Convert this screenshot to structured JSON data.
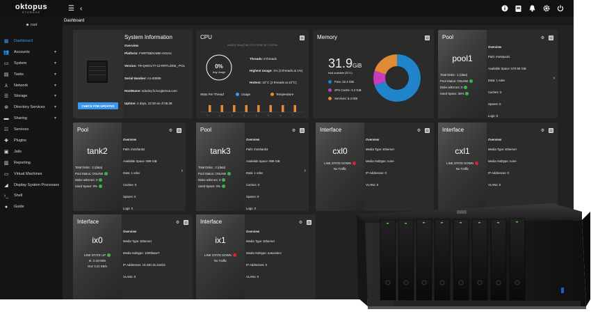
{
  "topbar": {
    "logo": "oktopus",
    "logo_sub": "STORAGE"
  },
  "breadcrumb": "Dashboard",
  "user": "root",
  "sidebar": {
    "items": [
      {
        "label": "Dashboard",
        "icon": "dashboard-icon",
        "active": true
      },
      {
        "label": "Accounts",
        "icon": "accounts-icon",
        "caret": true
      },
      {
        "label": "System",
        "icon": "system-icon",
        "caret": true
      },
      {
        "label": "Tasks",
        "icon": "tasks-icon",
        "caret": true
      },
      {
        "label": "Network",
        "icon": "network-icon",
        "caret": true
      },
      {
        "label": "Storage",
        "icon": "storage-icon",
        "caret": true
      },
      {
        "label": "Directory Services",
        "icon": "directory-icon",
        "caret": true
      },
      {
        "label": "Sharing",
        "icon": "sharing-icon",
        "caret": true
      },
      {
        "label": "Services",
        "icon": "services-icon"
      },
      {
        "label": "Plugins",
        "icon": "plugins-icon"
      },
      {
        "label": "Jails",
        "icon": "jails-icon"
      },
      {
        "label": "Reporting",
        "icon": "reporting-icon"
      },
      {
        "label": "Virtual Machines",
        "icon": "vm-icon"
      },
      {
        "label": "Display System Processes",
        "icon": "processes-icon"
      },
      {
        "label": "Shell",
        "icon": "shell-icon"
      },
      {
        "label": "Guide",
        "icon": "guide-icon"
      }
    ]
  },
  "sysinfo": {
    "title": "System Information",
    "overview": "Overview",
    "platform_label": "Platform:",
    "platform": "FWRTBBXABB AXGAx",
    "version_label": "Version:",
    "version": "TR-QWOLTT-12-RRTLZEM_-POL",
    "serial_label": "Serial Number:",
    "serial": "A1-83888",
    "hostname_label": "HostName:",
    "hostname": "sdudny.fx.bcrglemxa.com",
    "uptime_label": "Uptime:",
    "uptime": "4 days, 22:30 as of 05:38",
    "button": "CHECK FOR UPDATES"
  },
  "cpu": {
    "title": "CPU",
    "model": "Intel(R) Xeon(TM) CPU E3786 @ 2.20GHz",
    "avg_value": "0%",
    "avg_label": "Avg Usage",
    "threads_label": "Threads:",
    "threads": "8 threads",
    "highest_usage_label": "Highest Usage:",
    "highest_usage": "1% (3 threads at 1%)",
    "hottest_label": "Hottest:",
    "hottest": "42°C (2 threads at 42°C)",
    "stats_label": "Stats Per Thread",
    "legend_usage": "Usage",
    "legend_temp": "Temperature",
    "usage_color": "#3a98f0",
    "temp_color": "#e88a35",
    "thread_ticks": [
      "0",
      "1",
      "2",
      "3",
      "4",
      "5",
      "6",
      "7"
    ],
    "thread_temps": [
      0.42,
      0.42,
      0.42,
      0.42,
      0.42,
      0.42,
      0.42,
      0.42
    ]
  },
  "memory": {
    "title": "Memory",
    "total": "31.9",
    "unit": "GiB",
    "total_label": "total available (ECC)",
    "legend": [
      {
        "label": "Free: 22.4 GiB",
        "color": "#1f84c9"
      },
      {
        "label": "ZFS Cache: 3.2 GiB",
        "color": "#c63cbb"
      },
      {
        "label": "Services: 6.4 GiB",
        "color": "#e08a35"
      }
    ],
    "values": [
      22.4,
      3.2,
      6.4
    ]
  },
  "pools": [
    {
      "title": "Pool",
      "name": "pool1",
      "total_disks": "Total Disks :   1 (data)",
      "status": "Pool Status:   ONLINE",
      "errors": "Disks w/Errors: 0",
      "used": "Used Space:   36%",
      "overview": "Overview",
      "path": "Path:  /mnt/pool1",
      "available": "Available Space:  570.96 GiB",
      "data": "Data:  1 vdev",
      "caches": "Caches:  0",
      "spares": "Spares:  0",
      "logs": "Logs:  0"
    },
    {
      "title": "Pool",
      "name": "tank2",
      "total_disks": "Total Disks :   2 (data)",
      "status": "Pool Status:   ONLINE",
      "errors": "Disks w/Errors: 0",
      "used": "Used Space:   0%",
      "overview": "Overview",
      "path": "Path:  /mnt/tank2",
      "available": "Available Space:  899 GiB",
      "data": "Data:  1 vdev",
      "caches": "Caches:  0",
      "spares": "Spares:  0",
      "logs": "Logs:  0"
    },
    {
      "title": "Pool",
      "name": "tank3",
      "total_disks": "Total Disks :   2 (data)",
      "status": "Pool Status:   ONLINE",
      "errors": "Disks w/Errors: 0",
      "used": "Used Space:   0%",
      "overview": "Overview",
      "path": "Path:  /mnt/tank3",
      "available": "Available Space:  899 GiB",
      "data": "Data:  1 vdev",
      "caches": "Caches:  0",
      "spares": "Spares:  0",
      "logs": "Logs:  0"
    }
  ],
  "interfaces": [
    {
      "title": "Interface",
      "name": "cxl0",
      "state": "LINK STATE DOWN",
      "state_color": "red",
      "traffic": "No Traffic",
      "overview": "Overview",
      "media_type": "Media Type:  Ethernet",
      "media_subtype": "Media Subtype:  none",
      "ip": "IP Addresses:  0",
      "vlans": "VLANs:  0"
    },
    {
      "title": "Interface",
      "name": "cxl1",
      "state": "LINK STATE DOWN",
      "state_color": "red",
      "traffic": "No Traffic",
      "overview": "Overview",
      "media_type": "Media Type:  Ethernet",
      "media_subtype": "Media Subtype:  none",
      "ip": "IP Addresses:  0",
      "vlans": "VLANs:  0"
    },
    {
      "title": "Interface",
      "name": "ix0",
      "state": "LINK STATE UP",
      "state_color": "green",
      "in": "In:  2.18 KB/s",
      "out": "Out:  0.21 KB/s",
      "overview": "Overview",
      "media_type": "Media Type:  Ethernet",
      "media_subtype": "Media Subtype:  1000baseT",
      "ip": "IP Addresses:  10.230.15.116/22",
      "vlans": "VLANs:  0"
    },
    {
      "title": "Interface",
      "name": "ix1",
      "state": "LINK STATE DOWN",
      "state_color": "red",
      "traffic": "No Traffic",
      "overview": "Overview",
      "media_type": "Media Type:  Ethernet",
      "media_subtype": "Media Subtype:  autoselect",
      "ip": "IP Addresses:  0",
      "vlans": "VLANs:  0"
    }
  ]
}
